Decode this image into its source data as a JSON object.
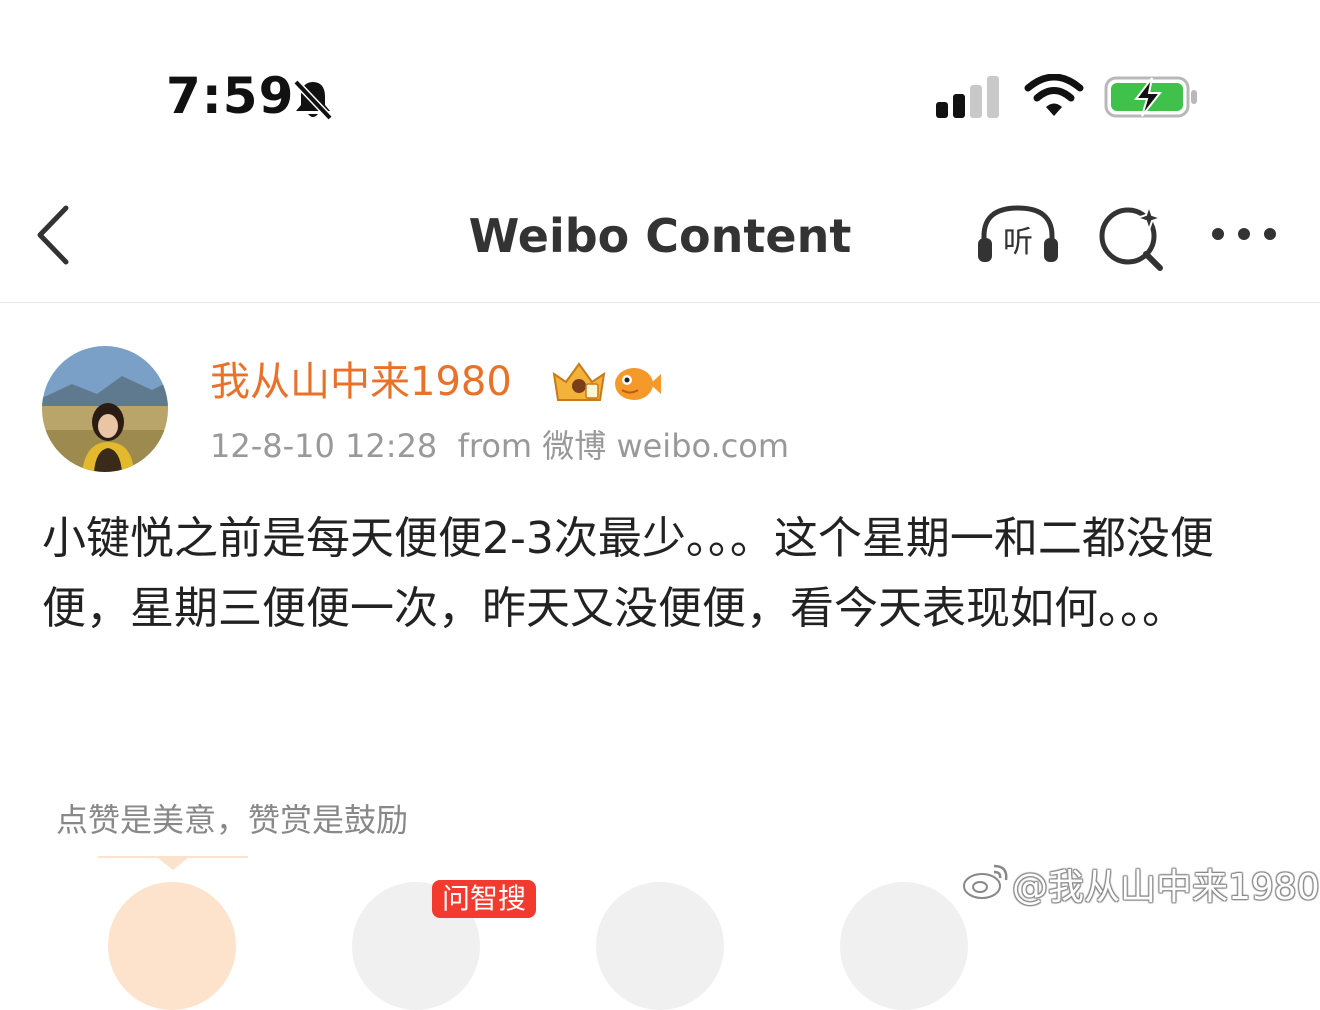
{
  "status_bar": {
    "time": "7:59",
    "icons": [
      "bell-slash-icon",
      "signal-icon",
      "wifi-icon",
      "battery-charging-icon"
    ],
    "battery_color": "#3fc24a"
  },
  "nav": {
    "title": "Weibo Content",
    "listen_label": "听",
    "icons": [
      "back-chevron-icon",
      "listen-headphones-icon",
      "search-sparkle-icon",
      "more-dots-icon"
    ]
  },
  "post": {
    "username": "我从山中来1980",
    "username_color": "#e8722b",
    "badges": [
      "crown-badge-icon",
      "fish-badge-icon"
    ],
    "timestamp": "12-8-10 12:28",
    "source": "from 微博 weibo.com",
    "content": "小键悦之前是每天便便2-3次最少。。。这个星期一和二都没便便，星期三便便一次，昨天又没便便，看今天表现如何。。。"
  },
  "footer": {
    "reward_text": "点赞是美意，赞赏是鼓励",
    "tag": "问智搜",
    "watermark": "@我从山中来1980"
  }
}
